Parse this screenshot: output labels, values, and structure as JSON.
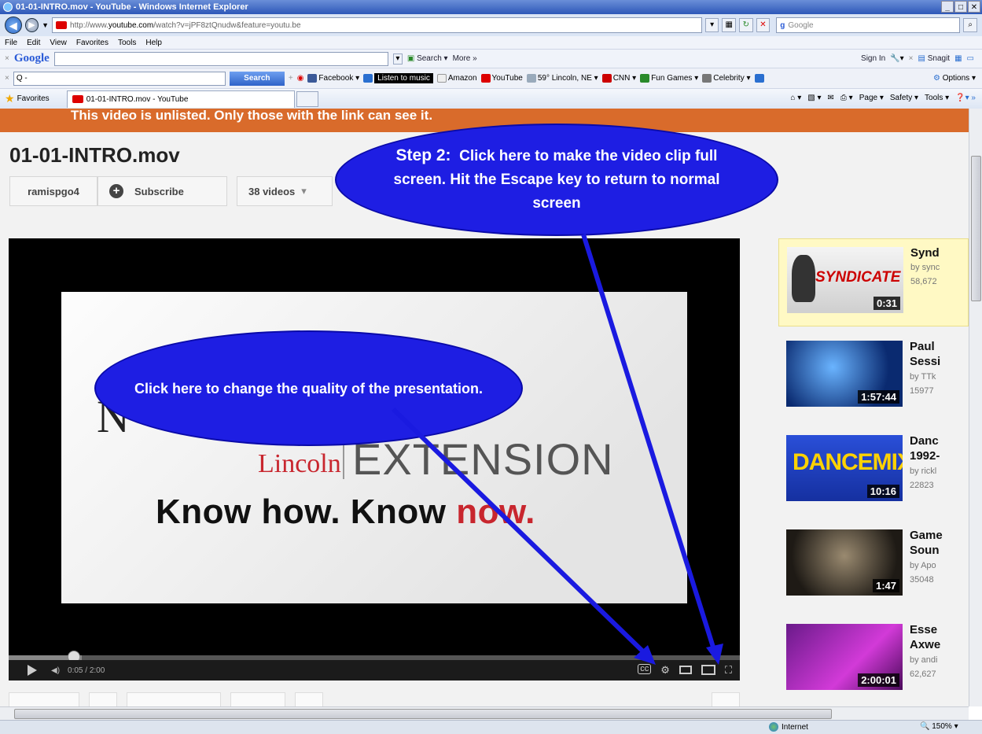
{
  "window": {
    "title": "01-01-INTRO.mov - YouTube - Windows Internet Explorer",
    "controls": [
      "_",
      "□",
      "✕"
    ]
  },
  "address": {
    "url_prefix": "http://www.",
    "url_domain": "youtube.com",
    "url_path": "/watch?v=jPF8ztQnudw&feature=youtu.be",
    "search_placeholder": "Google"
  },
  "menu": [
    "File",
    "Edit",
    "View",
    "Favorites",
    "Tools",
    "Help"
  ],
  "google_toolbar": {
    "logo": "Google",
    "search_label": "Search",
    "more_label": "More »",
    "sign_in": "Sign In",
    "snagit": "Snagit"
  },
  "links_toolbar": {
    "input_value": "Q -",
    "search_button": "Search",
    "links": [
      {
        "label": "Facebook",
        "color": "#3b5998"
      },
      {
        "label": "Listen to music",
        "color": "#000000"
      },
      {
        "label": "Amazon",
        "color": "#222222"
      },
      {
        "label": "YouTube",
        "color": "#d00000"
      },
      {
        "label": "59° Lincoln, NE",
        "color": "#3a6fb8"
      },
      {
        "label": "CNN",
        "color": "#cc0000"
      },
      {
        "label": "Fun Games",
        "color": "#2a8a2a"
      },
      {
        "label": "Celebrity",
        "color": "#444444"
      }
    ],
    "options": "Options"
  },
  "favorites_bar": {
    "favorites_label": "Favorites",
    "tab_title": "01-01-INTRO.mov - YouTube",
    "commands": [
      "Page ▾",
      "Safety ▾",
      "Tools ▾"
    ]
  },
  "page": {
    "banner": "This video is unlisted. Only those with the link can see it.",
    "video_title": "01-01-INTRO.mov",
    "channel": "ramispgo4",
    "subscribe": "Subscribe",
    "videos_count": "38 videos",
    "frame": {
      "nu": "N",
      "lincoln": "Lincoln",
      "extension": "EXTENSION",
      "slogan_a": "Know how. Know ",
      "slogan_b": "now."
    },
    "player": {
      "time": "0:05 / 2:00",
      "progress_fraction": 0.042,
      "loaded_fraction": 0.1
    }
  },
  "sidebar": [
    {
      "title": "Synd",
      "by": "by sync",
      "views": "58,672",
      "duration": "0:31",
      "highlighted": true
    },
    {
      "title": "Paul\nSessi",
      "by": "by TTk",
      "views": "15977",
      "duration": "1:57:44",
      "highlighted": false
    },
    {
      "title": "Danc\n1992-",
      "by": "by rickl",
      "views": "22823",
      "duration": "10:16",
      "highlighted": false
    },
    {
      "title": "Game\nSoun",
      "by": "by Apo",
      "views": "35048",
      "duration": "1:47",
      "highlighted": false
    },
    {
      "title": "Esse\nAxwe",
      "by": "by andi",
      "views": "62,627",
      "duration": "2:00:01",
      "highlighted": false
    }
  ],
  "thumbnail_labels": {
    "syndicate": "SYNDICATE",
    "dancemix": "DANCEMIX"
  },
  "status": {
    "zone": "Internet",
    "zoom": "150%"
  },
  "callouts": {
    "quality": "Click here to change the quality of the presentation.",
    "fullscreen_step": "Step 2:",
    "fullscreen_text": "Click here to make the video clip full screen.  Hit the Escape key to return to normal screen"
  },
  "colors": {
    "banner": "#d96b2b",
    "callout": "#1e1ee3",
    "arrow": "#1a1ae0",
    "accent_red": "#c8262e"
  }
}
